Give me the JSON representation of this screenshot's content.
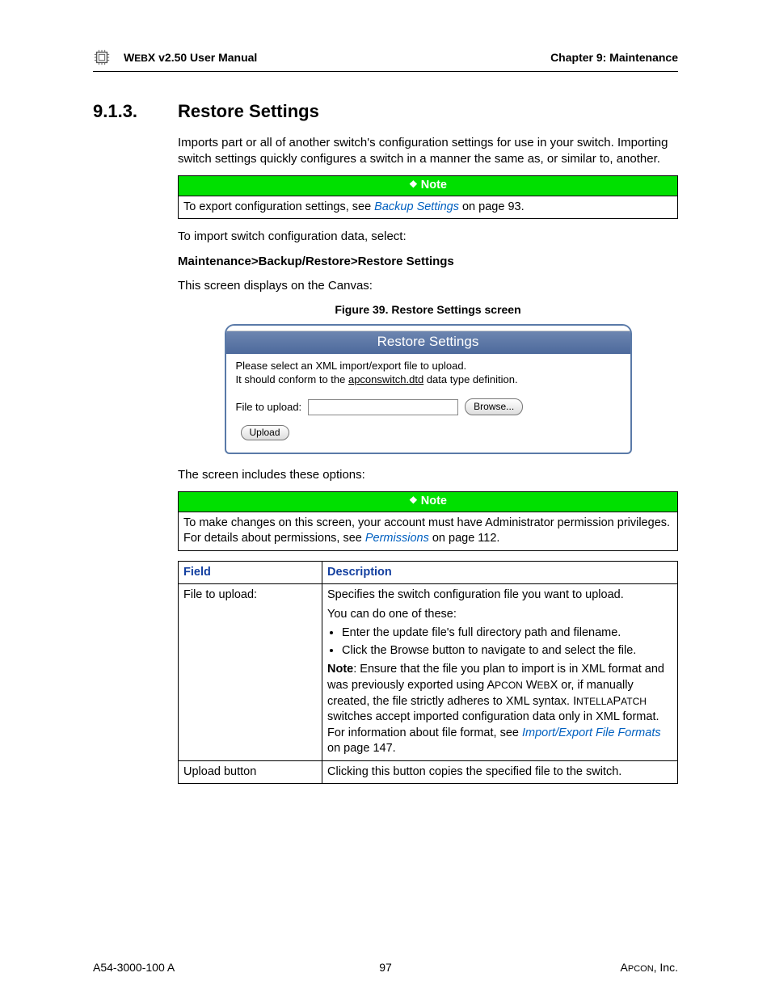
{
  "header": {
    "manual_title_prefix": "W",
    "manual_title_smallcaps": "EB",
    "manual_title_suffix": "X v2.50 User Manual",
    "chapter": "Chapter 9: Maintenance"
  },
  "section": {
    "number": "9.1.3.",
    "title": "Restore Settings"
  },
  "intro_para": "Imports part or all of another switch's configuration settings for use in your switch. Importing switch settings quickly configures a switch in a manner the same as, or similar to, another.",
  "note1": {
    "label": "Note",
    "text_pre": "To export configuration settings, see ",
    "link": "Backup Settings",
    "text_post": " on page 93."
  },
  "import_line": "To import switch configuration data, select:",
  "breadcrumb": "Maintenance>Backup/Restore>Restore Settings",
  "canvas_line": "This screen displays on the Canvas:",
  "figure_caption": "Figure 39. Restore Settings screen",
  "screenshot": {
    "title": "Restore Settings",
    "line1": "Please select an XML import/export file to upload.",
    "line2_pre": "It should conform to the ",
    "line2_dtd": "apconswitch.dtd",
    "line2_post": " data type definition.",
    "file_label": "File to upload:",
    "browse_label": "Browse...",
    "upload_label": "Upload"
  },
  "options_intro": "The screen includes these options:",
  "note2": {
    "label": "Note",
    "text_pre": "To make changes on this screen, your account must have Administrator permission privileges. For details about permissions, see ",
    "link": "Permissions",
    "text_post": " on page 112."
  },
  "field_table": {
    "head_field": "Field",
    "head_desc": "Description",
    "rows": [
      {
        "field": "File to upload:",
        "desc_line1": "Specifies the switch configuration file you want to upload.",
        "desc_line2": "You can do one of these:",
        "bullets": [
          "Enter the update file's full directory path and filename.",
          "Click the Browse button to navigate to and select the file."
        ],
        "note_label": "Note",
        "note_body_a": ": Ensure that the file you plan to import is in XML format and was previously exported using A",
        "note_sc1": "PCON",
        "note_body_b": " W",
        "note_sc2": "EB",
        "note_body_c": "X or, if manually created, the file strictly adheres to XML syntax. I",
        "note_sc3": "NTELLA",
        "note_body_d": "P",
        "note_sc4": "ATCH",
        "note_body_e": " switches accept imported configuration data only in XML format. For information about file format, see ",
        "note_link": "Import/Export File Formats",
        "note_body_f": " on page 147."
      },
      {
        "field": "Upload button",
        "desc": "Clicking this button copies the specified file to the switch."
      }
    ]
  },
  "footer": {
    "left": "A54-3000-100 A",
    "center": "97",
    "right_pre": "A",
    "right_sc": "PCON",
    "right_post": ", Inc."
  }
}
